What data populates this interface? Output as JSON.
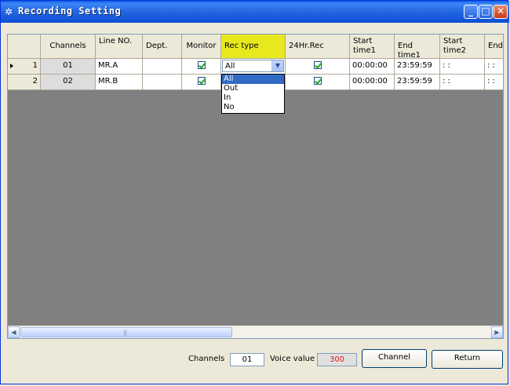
{
  "window": {
    "title": "Recording Setting"
  },
  "grid": {
    "columns": [
      "Channels",
      "Line NO.",
      "Dept.",
      "Monitor",
      "Rec type",
      "24Hr.Rec",
      "Start time1",
      "End time1",
      "Start time2",
      "End"
    ],
    "selected_column": "Rec type",
    "rows": [
      {
        "num": "1",
        "channel": "01",
        "line": "MR.A",
        "dept": "",
        "monitor": true,
        "rec_type": "All",
        "rec24": true,
        "start1": "00:00:00",
        "end1": "23:59:59",
        "start2": ": :",
        "end2": ": :"
      },
      {
        "num": "2",
        "channel": "02",
        "line": "MR.B",
        "dept": "",
        "monitor": true,
        "rec_type": "",
        "rec24": true,
        "start1": "00:00:00",
        "end1": "23:59:59",
        "start2": ": :",
        "end2": ": :"
      }
    ]
  },
  "rec_type_dropdown": {
    "selected": "All",
    "options": [
      "All",
      "Out",
      "In",
      "No"
    ]
  },
  "footer": {
    "channels_label": "Channels",
    "channels_value": "01",
    "voice_label": "Voice value",
    "voice_value": "300",
    "channel_button": "Channel",
    "return_button": "Return"
  },
  "colors": {
    "selected_header": "#e8e81e",
    "voice_value_text": "#e0201c",
    "title_bar": "#2466e0"
  }
}
